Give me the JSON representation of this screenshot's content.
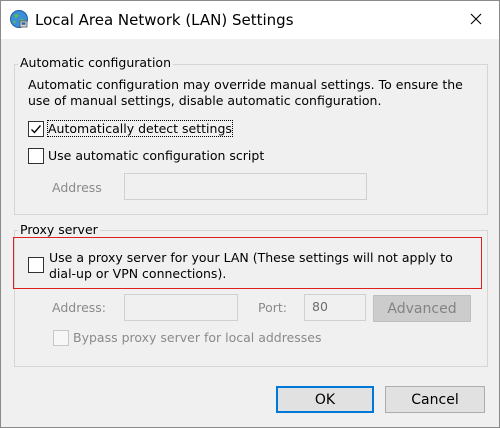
{
  "window": {
    "title": "Local Area Network (LAN) Settings",
    "icon": "network-globe-icon",
    "close_icon": "close-icon"
  },
  "auto_config": {
    "group_label": "Automatic configuration",
    "description": "Automatic configuration may override manual settings.  To ensure the use of manual settings, disable automatic configuration.",
    "detect_label": "Automatically detect settings",
    "detect_checked": true,
    "script_label": "Use automatic configuration script",
    "script_checked": false,
    "address_label": "Address",
    "address_value": ""
  },
  "proxy": {
    "group_label": "Proxy server",
    "use_proxy_label_line1": "Use a proxy server for your LAN (These settings will not apply to",
    "use_proxy_label_line2": "dial-up or VPN connections).",
    "use_proxy_checked": false,
    "address_label": "Address:",
    "address_value": "",
    "port_label": "Port:",
    "port_value": "80",
    "advanced_label": "Advanced",
    "bypass_label": "Bypass proxy server for local addresses",
    "bypass_checked": false
  },
  "buttons": {
    "ok_label": "OK",
    "cancel_label": "Cancel"
  },
  "colors": {
    "highlight_border": "#e02020",
    "default_button_border": "#0078d7"
  }
}
